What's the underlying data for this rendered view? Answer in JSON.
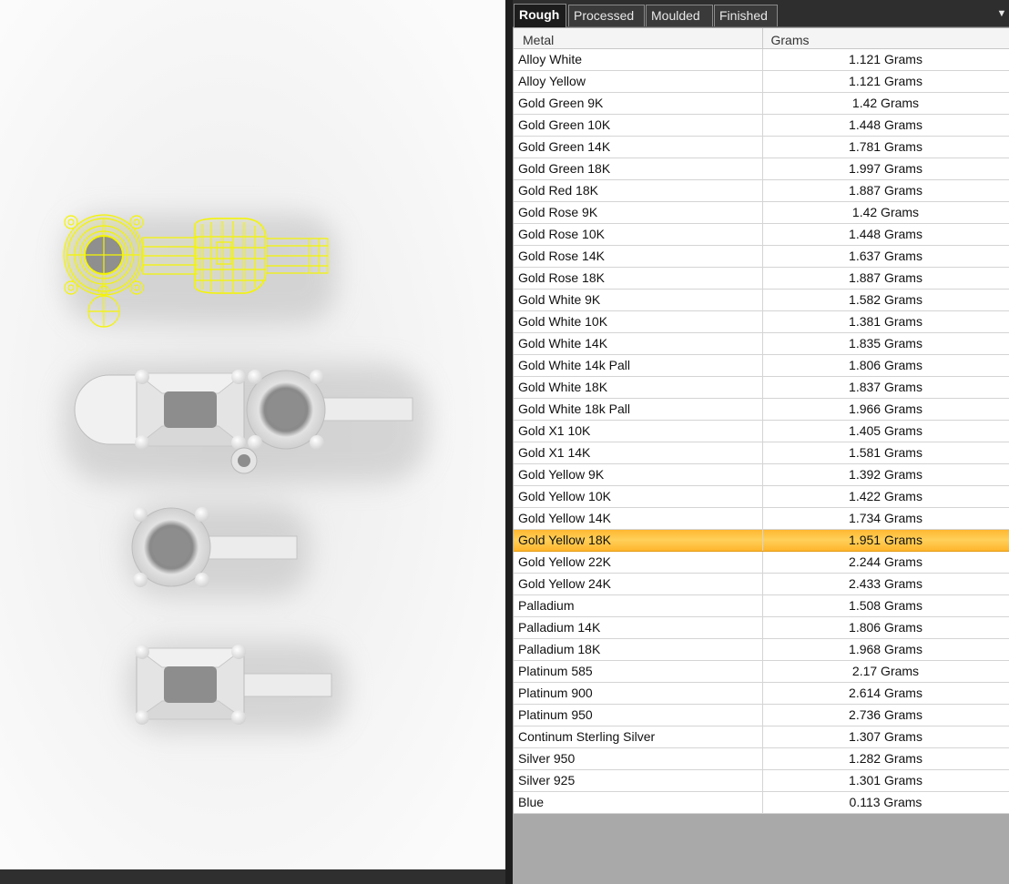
{
  "tabs": [
    {
      "label": "Rough",
      "active": true
    },
    {
      "label": "Processed",
      "active": false
    },
    {
      "label": "Moulded",
      "active": false
    },
    {
      "label": "Finished",
      "active": false
    }
  ],
  "dropdown_icon": "chevron-down-icon",
  "table": {
    "headers": {
      "metal": "Metal",
      "grams": "Grams"
    },
    "selected_row": "Gold Yellow 18K",
    "rows": [
      {
        "metal": "Alloy White",
        "grams": "1.121 Grams"
      },
      {
        "metal": "Alloy Yellow",
        "grams": "1.121 Grams"
      },
      {
        "metal": "Gold Green 9K",
        "grams": "1.42 Grams"
      },
      {
        "metal": "Gold Green 10K",
        "grams": "1.448 Grams"
      },
      {
        "metal": "Gold Green 14K",
        "grams": "1.781 Grams"
      },
      {
        "metal": "Gold Green 18K",
        "grams": "1.997 Grams"
      },
      {
        "metal": "Gold Red 18K",
        "grams": "1.887 Grams"
      },
      {
        "metal": "Gold Rose 9K",
        "grams": "1.42 Grams"
      },
      {
        "metal": "Gold Rose 10K",
        "grams": "1.448 Grams"
      },
      {
        "metal": "Gold Rose 14K",
        "grams": "1.637 Grams"
      },
      {
        "metal": "Gold Rose 18K",
        "grams": "1.887 Grams"
      },
      {
        "metal": "Gold White 9K",
        "grams": "1.582 Grams"
      },
      {
        "metal": "Gold White 10K",
        "grams": "1.381 Grams"
      },
      {
        "metal": "Gold White 14K",
        "grams": "1.835 Grams"
      },
      {
        "metal": "Gold White 14k Pall",
        "grams": "1.806 Grams"
      },
      {
        "metal": "Gold White 18K",
        "grams": "1.837 Grams"
      },
      {
        "metal": "Gold White 18k Pall",
        "grams": "1.966 Grams"
      },
      {
        "metal": "Gold X1 10K",
        "grams": "1.405 Grams"
      },
      {
        "metal": "Gold X1 14K",
        "grams": "1.581 Grams"
      },
      {
        "metal": "Gold Yellow 9K",
        "grams": "1.392 Grams"
      },
      {
        "metal": "Gold Yellow 10K",
        "grams": "1.422 Grams"
      },
      {
        "metal": "Gold Yellow 14K",
        "grams": "1.734 Grams"
      },
      {
        "metal": "Gold Yellow 18K",
        "grams": "1.951 Grams"
      },
      {
        "metal": "Gold Yellow 22K",
        "grams": "2.244 Grams"
      },
      {
        "metal": "Gold Yellow 24K",
        "grams": "2.433 Grams"
      },
      {
        "metal": "Palladium",
        "grams": "1.508 Grams"
      },
      {
        "metal": "Palladium 14K",
        "grams": "1.806 Grams"
      },
      {
        "metal": "Palladium 18K",
        "grams": "1.968 Grams"
      },
      {
        "metal": "Platinum 585",
        "grams": "2.17 Grams"
      },
      {
        "metal": "Platinum 900",
        "grams": "2.614 Grams"
      },
      {
        "metal": "Platinum 950",
        "grams": "2.736 Grams"
      },
      {
        "metal": "Continum Sterling Silver",
        "grams": "1.307 Grams"
      },
      {
        "metal": "Silver 950",
        "grams": "1.282 Grams"
      },
      {
        "metal": "Silver 925",
        "grams": "1.301 Grams"
      },
      {
        "metal": "Blue",
        "grams": "0.113 Grams"
      }
    ]
  },
  "colors": {
    "selection": "#ffc13d",
    "wireframe": "#f5f500",
    "viewport_bg": "#f9f9f9",
    "tabbar_bg": "#2e2e2e"
  }
}
